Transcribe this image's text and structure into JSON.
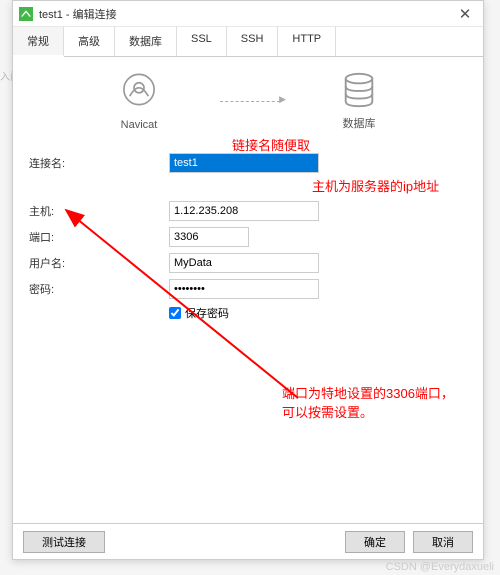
{
  "window": {
    "title": "test1 - 编辑连接",
    "icon_name": "navicat-app-icon"
  },
  "tabs": [
    "常规",
    "高级",
    "数据库",
    "SSL",
    "SSH",
    "HTTP"
  ],
  "active_tab": 0,
  "icons": {
    "left_label": "Navicat",
    "right_label": "数据库"
  },
  "form": {
    "conn_name_label": "连接名:",
    "conn_name_value": "test1",
    "host_label": "主机:",
    "host_value": "1.12.235.208",
    "port_label": "端口:",
    "port_value": "3306",
    "user_label": "用户名:",
    "user_value": "MyData",
    "pass_label": "密码:",
    "pass_value": "••••••••",
    "save_pass_label": "保存密码"
  },
  "footer": {
    "test": "测试连接",
    "ok": "确定",
    "cancel": "取消"
  },
  "annotations": {
    "a1": "链接名随便取",
    "a2": "主机为服务器的ip地址",
    "a3_line1": "端口为特地设置的3306端口，",
    "a3_line2": "可以按需设置。"
  },
  "watermark": "CSDN @Everydaxueli",
  "bg_text": "入问"
}
